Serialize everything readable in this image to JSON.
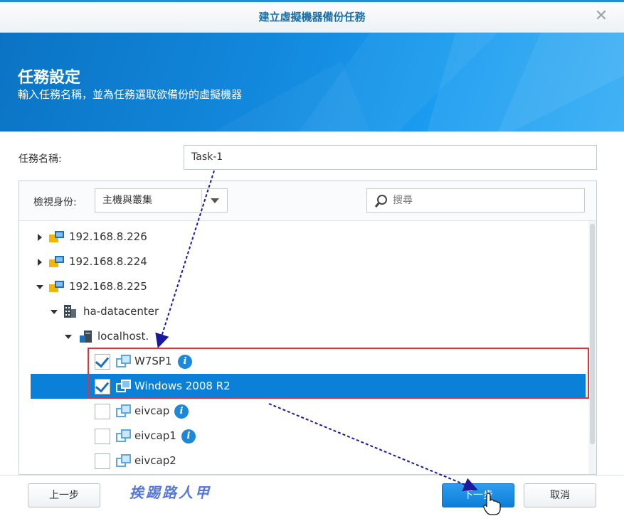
{
  "window": {
    "title": "建立虛擬機器備份任務",
    "close_icon": "close-icon"
  },
  "banner": {
    "title": "任務設定",
    "subtitle": "輸入任務名稱，並為任務選取欲備份的虛擬機器"
  },
  "form": {
    "task_name_label": "任務名稱:",
    "task_name_value": "Task-1"
  },
  "panel": {
    "view_label": "檢視身份:",
    "view_select_value": "主機與叢集",
    "search_placeholder": "搜尋"
  },
  "tree": {
    "items": [
      {
        "label": "192.168.8.226",
        "icon": "host-icon",
        "state": "collapsed"
      },
      {
        "label": "192.168.8.224",
        "icon": "host-icon",
        "state": "collapsed"
      },
      {
        "label": "192.168.8.225",
        "icon": "host-icon",
        "state": "expanded"
      },
      {
        "label": "ha-datacenter",
        "icon": "datacenter-icon",
        "state": "expanded"
      },
      {
        "label": "localhost.",
        "icon": "server-icon",
        "state": "expanded"
      },
      {
        "label": "W7SP1",
        "icon": "vm-icon",
        "checked": true,
        "info": true
      },
      {
        "label": "Windows 2008 R2",
        "icon": "vm-icon",
        "checked": true,
        "selected": true
      },
      {
        "label": "eivcap",
        "icon": "vm-icon",
        "checked": false,
        "info": true
      },
      {
        "label": "eivcap1",
        "icon": "vm-icon",
        "checked": false,
        "info": true
      },
      {
        "label": "eivcap2",
        "icon": "vm-icon",
        "checked": false
      }
    ]
  },
  "footer": {
    "prev_label": "上一步",
    "next_label": "下一步",
    "cancel_label": "取消",
    "watermark": "挨踢路人甲"
  },
  "colors": {
    "accent": "#0b80d8",
    "title_text": "#1a6fa8",
    "highlight": "#d8343b",
    "annotation": "#1a1aa0"
  }
}
